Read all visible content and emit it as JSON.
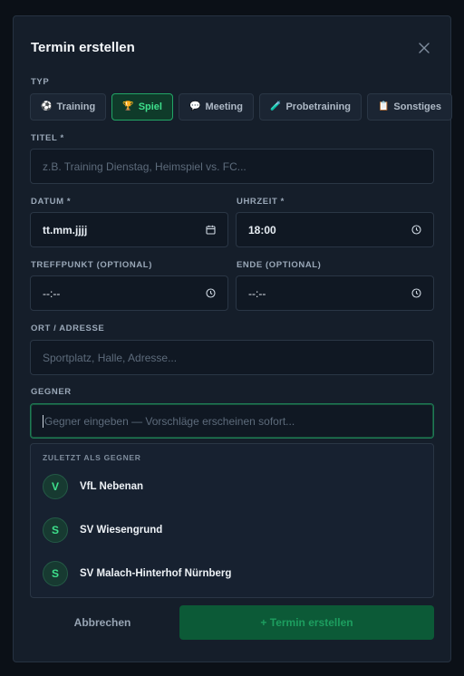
{
  "dialog": {
    "title": "Termin erstellen",
    "close_icon": "close-icon"
  },
  "type": {
    "label": "TYP",
    "options": [
      {
        "icon": "⚽",
        "label": "Training",
        "active": false
      },
      {
        "icon": "🏆",
        "label": "Spiel",
        "active": true
      },
      {
        "icon": "💬",
        "label": "Meeting",
        "active": false
      },
      {
        "icon": "🧪",
        "label": "Probetraining",
        "active": false
      },
      {
        "icon": "📋",
        "label": "Sonstiges",
        "active": false
      }
    ]
  },
  "title_field": {
    "label": "TITEL *",
    "placeholder": "z.B. Training Dienstag, Heimspiel vs. FC..."
  },
  "date_field": {
    "label": "DATUM *",
    "value": "tt.mm.jjjj"
  },
  "time_field": {
    "label": "UHRZEIT *",
    "value": "18:00"
  },
  "meet_field": {
    "label": "TREFFPUNKT (OPTIONAL)",
    "value": "--:--"
  },
  "end_field": {
    "label": "ENDE (OPTIONAL)",
    "value": "--:--"
  },
  "location_field": {
    "label": "ORT / ADRESSE",
    "placeholder": "Sportplatz, Halle, Adresse..."
  },
  "opponent_field": {
    "label": "GEGNER",
    "placeholder": "Gegner eingeben — Vorschläge erscheinen sofort..."
  },
  "suggestions": {
    "heading": "ZULETZT ALS GEGNER",
    "items": [
      {
        "initial": "V",
        "name": "VfL Nebenan"
      },
      {
        "initial": "S",
        "name": "SV Wiesengrund"
      },
      {
        "initial": "S",
        "name": "SV Malach-Hinterhof Nürnberg"
      }
    ]
  },
  "actions": {
    "cancel": "Abbrechen",
    "create": "+ Termin erstellen"
  },
  "colors": {
    "accent": "#3ee08c",
    "primary_button": "#0c5a37",
    "background": "#0b1017",
    "panel": "#151e2a"
  }
}
